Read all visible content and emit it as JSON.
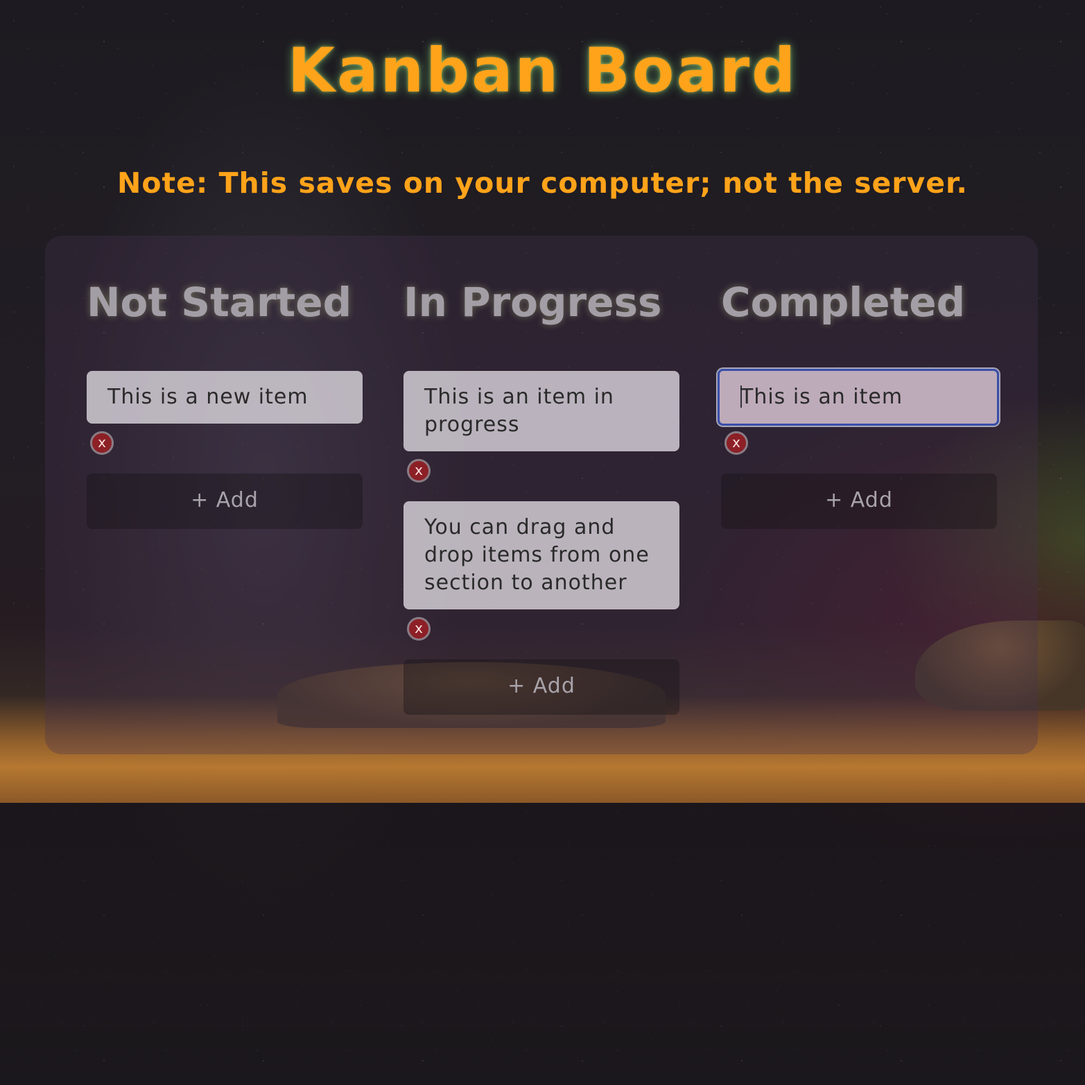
{
  "page": {
    "title": "Kanban Board",
    "note": "Note: This saves on your computer; not the server."
  },
  "columns": [
    {
      "title": "Not Started",
      "items": [
        "This is a new item"
      ],
      "delete_label": "x",
      "add_label": "+ Add"
    },
    {
      "title": "In Progress",
      "items": [
        "This is an item in progress",
        "You can drag and drop items from one section to another"
      ],
      "delete_label": "x",
      "add_label": "+ Add"
    },
    {
      "title": "Completed",
      "items": [
        "This is an item"
      ],
      "delete_label": "x",
      "add_label": "+ Add"
    }
  ],
  "colors": {
    "accent": "#ffa31a",
    "delete": "#8c2026",
    "focus_border": "#3b4fa8"
  },
  "icons": {
    "delete": "close-icon"
  }
}
